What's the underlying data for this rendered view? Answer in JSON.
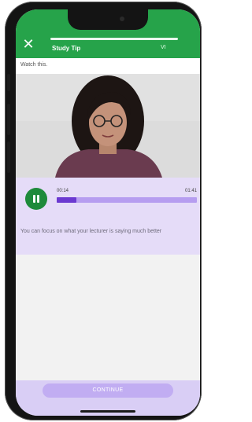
{
  "header": {
    "close_icon": "close-icon",
    "title": "Study Tip",
    "step": "VI"
  },
  "prompt": {
    "text": "Watch this."
  },
  "video": {
    "subject": "presenter-portrait"
  },
  "player": {
    "control_icon": "pause-icon",
    "current_time": "00:14",
    "total_time": "01:41",
    "progress": 0.14
  },
  "caption": {
    "text": "You can focus on what your lecturer is saying much better"
  },
  "footer": {
    "continue_label": "CONTINUE"
  },
  "colors": {
    "header_green": "#26a34a",
    "play_button": "#1e8a3b",
    "track": "#b69df0",
    "fill": "#6b39d1",
    "panel_lilac": "#e5dcf8",
    "continue_button": "#c1adf2"
  }
}
